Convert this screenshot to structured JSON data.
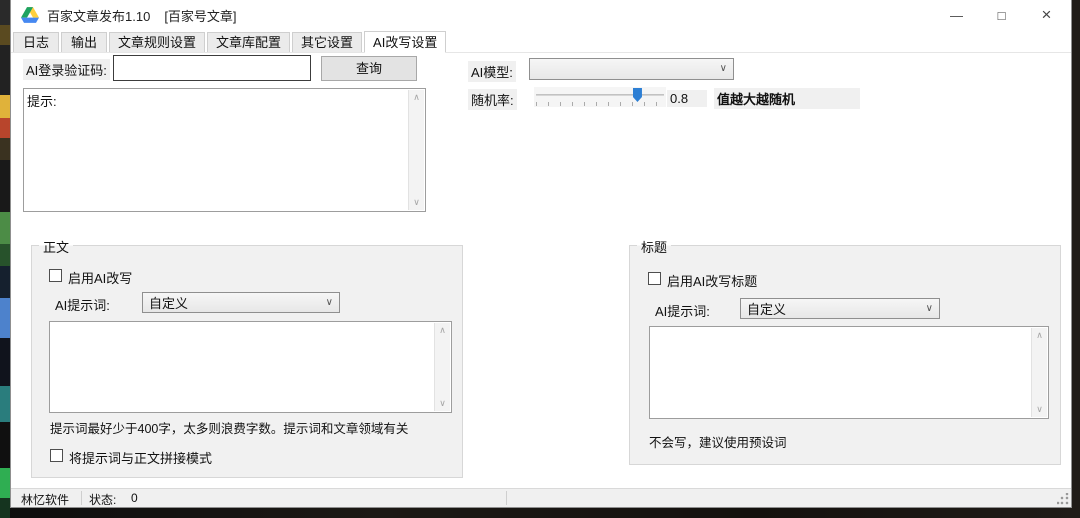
{
  "window": {
    "title": "百家文章发布1.10",
    "subtitle": "[百家号文章]"
  },
  "icons": {
    "minimize": "—",
    "maximize": "□",
    "close": "×",
    "chevron_down": "∨",
    "scroll_up": "∧",
    "scroll_down": "∨"
  },
  "tabs": [
    {
      "label": "日志",
      "active": false
    },
    {
      "label": "输出",
      "active": false
    },
    {
      "label": "文章规则设置",
      "active": false
    },
    {
      "label": "文章库配置",
      "active": false
    },
    {
      "label": "其它设置",
      "active": false
    },
    {
      "label": "AI改写设置",
      "active": true
    }
  ],
  "ai_login": {
    "label": "AI登录验证码:",
    "value": "",
    "query_button": "查询"
  },
  "hint_box": {
    "text": "提示:"
  },
  "model": {
    "label": "AI模型:",
    "value": ""
  },
  "random": {
    "label": "随机率:",
    "value": "0.8",
    "hint": "值越大越随机",
    "slider_percent": 78
  },
  "body_group": {
    "legend": "正文",
    "enable_checkbox_label": "启用AI改写",
    "enable_checked": false,
    "prompt_label": "AI提示词:",
    "prompt_value": "自定义",
    "textarea_value": "",
    "hint": "提示词最好少于400字，太多则浪费字数。提示词和文章领域有关",
    "concat_checkbox_label": "将提示词与正文拼接模式",
    "concat_checked": false
  },
  "title_group": {
    "legend": "标题",
    "enable_checkbox_label": "启用AI改写标题",
    "enable_checked": false,
    "prompt_label": "AI提示词:",
    "prompt_value": "自定义",
    "textarea_value": "",
    "hint": "不会写，建议使用预设词"
  },
  "statusbar": {
    "brand": "林忆软件",
    "status_label": "状态:",
    "status_value": "0"
  },
  "colors": {
    "accent_blue": "#2d7fd4",
    "control_gray": "#f0f0f0",
    "titlebar": "#ffffff"
  }
}
